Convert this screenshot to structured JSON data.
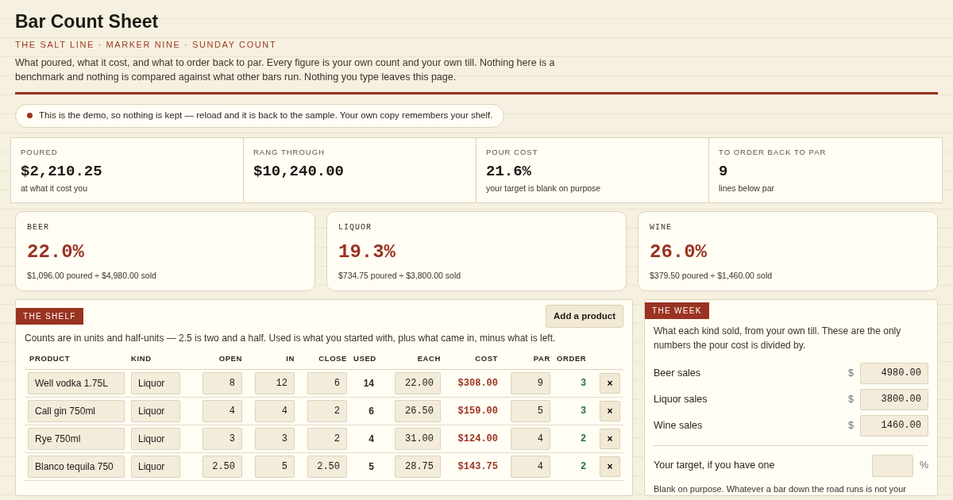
{
  "header": {
    "title": "Bar Count Sheet",
    "subtitle": "THE SALT LINE · MARKER NINE · SUNDAY COUNT",
    "intro": "What poured, what it cost, and what to order back to par. Every figure is your own count and your own till. Nothing here is a benchmark and nothing is compared against what other bars run. Nothing you type leaves this page."
  },
  "notice": {
    "text": "This is the demo, so nothing is kept — reload and it is back to the sample. Your own copy remembers your shelf."
  },
  "summary": [
    {
      "label": "POURED",
      "value": "$2,210.25",
      "note": "at what it cost you"
    },
    {
      "label": "RANG THROUGH",
      "value": "$10,240.00"
    },
    {
      "label": "POUR COST",
      "value": "21.6%",
      "note": "your target is blank on purpose"
    },
    {
      "label": "TO ORDER BACK TO PAR",
      "value": "9",
      "note": "lines below par"
    }
  ],
  "kinds": [
    {
      "label": "BEER",
      "percent": "22.0%",
      "detail": "$1,096.00 poured ÷ $4,980.00 sold"
    },
    {
      "label": "LIQUOR",
      "percent": "19.3%",
      "detail": "$734.75 poured ÷ $3,800.00 sold"
    },
    {
      "label": "WINE",
      "percent": "26.0%",
      "detail": "$379.50 poured ÷ $1,460.00 sold"
    }
  ],
  "shelf": {
    "tag": "THE SHELF",
    "add_button": "Add a product",
    "note": "Counts are in units and half-units — 2.5 is two and a half. Used is what you started with, plus what came in, minus what is left.",
    "columns": [
      "PRODUCT",
      "KIND",
      "OPEN",
      "IN",
      "CLOSE",
      "USED",
      "EACH",
      "COST",
      "PAR",
      "ORDER"
    ],
    "rows": [
      {
        "product": "Well vodka 1.75L",
        "kind": "Liquor",
        "open": "8",
        "in": "12",
        "close": "6",
        "used": "14",
        "each": "22.00",
        "cost": "$308.00",
        "par": "9",
        "order": "3",
        "delete": "×"
      },
      {
        "product": "Call gin 750ml",
        "kind": "Liquor",
        "open": "4",
        "in": "4",
        "close": "2",
        "used": "6",
        "each": "26.50",
        "cost": "$159.00",
        "par": "5",
        "order": "3",
        "delete": "×"
      },
      {
        "product": "Rye 750ml",
        "kind": "Liquor",
        "open": "3",
        "in": "3",
        "close": "2",
        "used": "4",
        "each": "31.00",
        "cost": "$124.00",
        "par": "4",
        "order": "2",
        "delete": "×"
      },
      {
        "product": "Blanco tequila 750",
        "kind": "Liquor",
        "open": "2.50",
        "in": "5",
        "close": "2.50",
        "used": "5",
        "each": "28.75",
        "cost": "$143.75",
        "par": "4",
        "order": "2",
        "delete": "×"
      }
    ]
  },
  "week": {
    "tag": "THE WEEK",
    "note": "What each kind sold, from your own till. These are the only numbers the pour cost is divided by.",
    "sales": [
      {
        "label": "Beer sales",
        "currency": "$",
        "value": "4980.00"
      },
      {
        "label": "Liquor sales",
        "currency": "$",
        "value": "3800.00"
      },
      {
        "label": "Wine sales",
        "currency": "$",
        "value": "1460.00"
      }
    ],
    "target": {
      "label": "Your target, if you have one",
      "unit": "%"
    },
    "footnote": "Blank on purpose. Whatever a bar down the road runs is not your"
  }
}
